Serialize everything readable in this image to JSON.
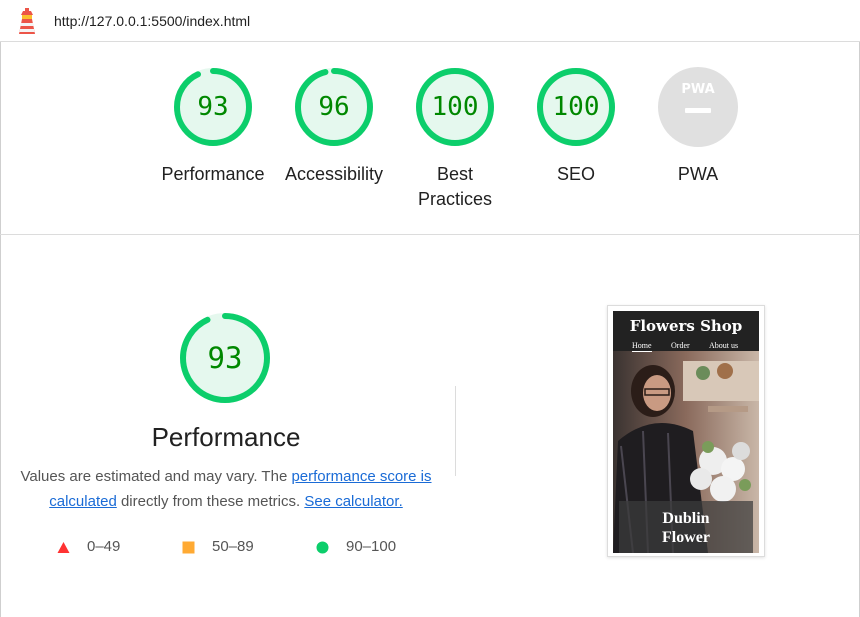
{
  "address_bar": {
    "url": "http://127.0.0.1:5500/index.html",
    "icon": "lighthouse-icon"
  },
  "scores": [
    {
      "label": "Performance",
      "value": "93",
      "fraction": 0.93,
      "color": "#0cce6b"
    },
    {
      "label": "Accessibility",
      "value": "96",
      "fraction": 0.96,
      "color": "#0cce6b"
    },
    {
      "label_line1": "Best",
      "label_line2": "Practices",
      "value": "100",
      "fraction": 1.0,
      "color": "#0cce6b"
    },
    {
      "label": "SEO",
      "value": "100",
      "fraction": 1.0,
      "color": "#0cce6b"
    },
    {
      "label": "PWA",
      "badge_text": "PWA",
      "color": "#e0e0e0"
    }
  ],
  "performance_detail": {
    "score": "93",
    "fraction": 0.93,
    "title": "Performance",
    "desc_part1": "Values are estimated and may vary. The ",
    "link1": "performance score is calculated",
    "desc_part2": " directly from these metrics. ",
    "link2": "See calculator.",
    "legend": [
      {
        "shape": "triangle",
        "color": "#ff3333",
        "range": "0–49"
      },
      {
        "shape": "square",
        "color": "#ffaa33",
        "range": "50–89"
      },
      {
        "shape": "circle",
        "color": "#0cce6b",
        "range": "90–100"
      }
    ]
  },
  "screenshot": {
    "brand": "Flowers Shop",
    "nav": [
      "Home",
      "Order",
      "About us"
    ],
    "hero_line1": "Dublin",
    "hero_line2": "Flower"
  },
  "colors": {
    "pass_green": "#0cce6b",
    "pass_text": "#008800",
    "pass_fill": "#e5f8ee",
    "link": "#1a6bd6"
  }
}
